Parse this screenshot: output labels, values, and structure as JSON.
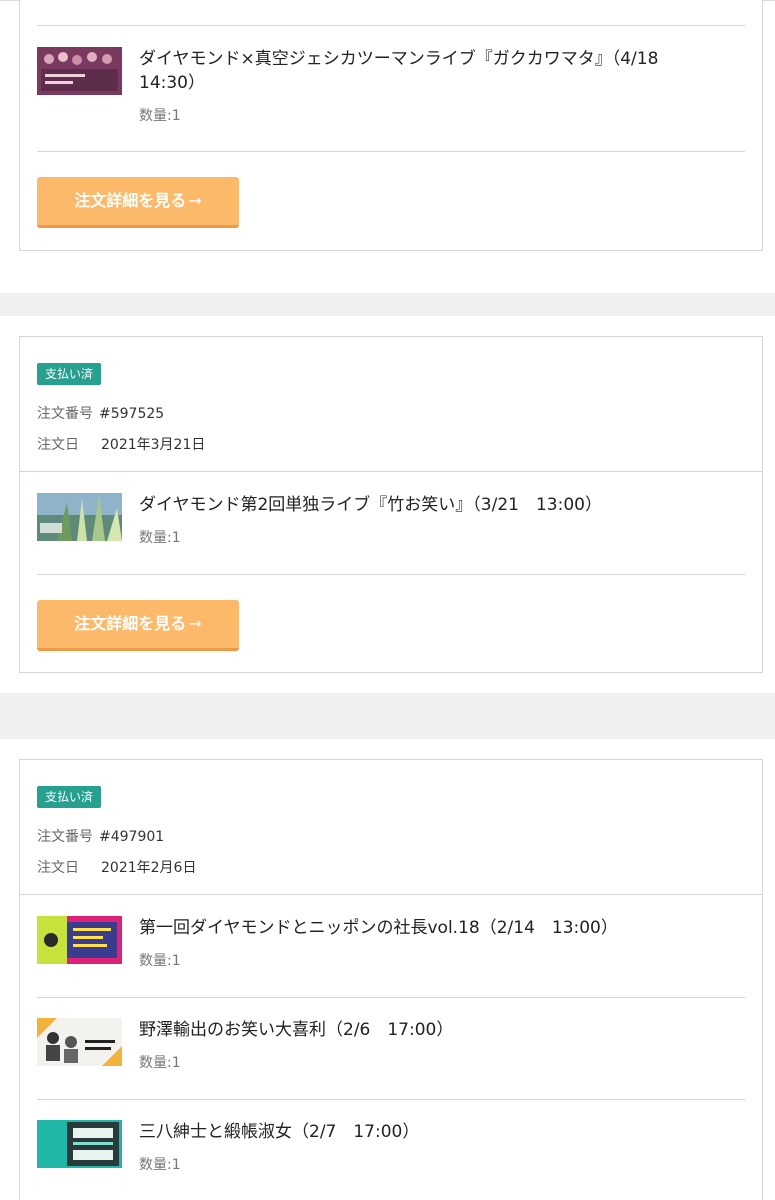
{
  "orders": [
    {
      "items": [
        {
          "title": "ダイヤモンド×真空ジェシカツーマンライブ『ガクカワマタ』（4/18　14:30）",
          "qty": "数量:1"
        }
      ],
      "button_label": "注文詳細を見る",
      "button_icon": "→"
    },
    {
      "status": "支払い済",
      "order_number_label": "注文番号",
      "order_number": "#597525",
      "date_label": "注文日",
      "date": "2021年3月21日",
      "items": [
        {
          "title": "ダイヤモンド第2回単独ライブ『竹お笑い』（3/21　13:00）",
          "qty": "数量:1"
        }
      ],
      "button_label": "注文詳細を見る",
      "button_icon": "→"
    },
    {
      "status": "支払い済",
      "order_number_label": "注文番号",
      "order_number": "#497901",
      "date_label": "注文日",
      "date": "2021年2月6日",
      "items": [
        {
          "title": "第一回ダイヤモンドとニッポンの社長vol.18（2/14　13:00）",
          "qty": "数量:1"
        },
        {
          "title": "野澤輸出のお笑い大喜利（2/6　17:00）",
          "qty": "数量:1"
        },
        {
          "title": "三八紳士と緞帳淑女（2/7　17:00）",
          "qty": "数量:1"
        }
      ]
    }
  ],
  "colors": {
    "badge": "#26a08f",
    "button": "#fdb96a",
    "button_border": "#ec9a45"
  }
}
